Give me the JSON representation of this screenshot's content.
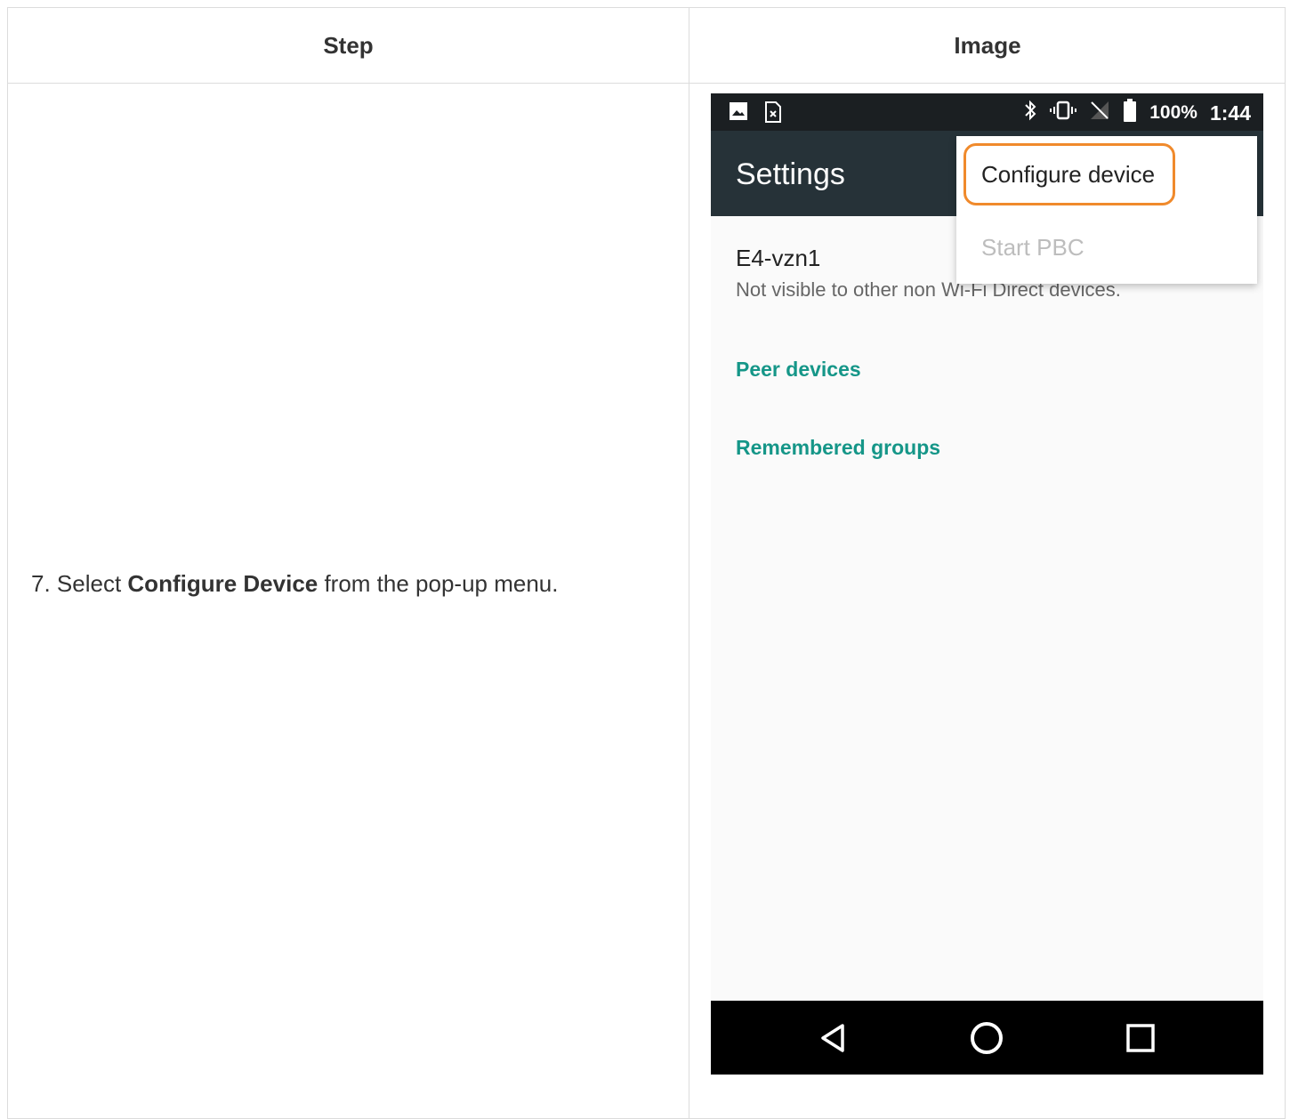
{
  "table": {
    "header_step": "Step",
    "header_image": "Image",
    "step_prefix": "7. Select ",
    "step_bold": "Configure Device",
    "step_suffix": " from the pop-up menu."
  },
  "phone": {
    "status": {
      "battery_percent": "100%",
      "time": "1:44",
      "icons": [
        "gallery-icon",
        "sim-card-icon",
        "bluetooth-icon",
        "vibrate-icon",
        "no-signal-icon",
        "battery-icon"
      ]
    },
    "appbar": {
      "title": "Settings"
    },
    "device": {
      "name": "E4-vzn1",
      "visibility": "Not visible to other non Wi-Fi Direct devices."
    },
    "sections": {
      "peer": "Peer devices",
      "remembered": "Remembered groups"
    },
    "menu": {
      "items": [
        "Configure device",
        "Start PBC"
      ],
      "highlight_color": "#f08a2c"
    },
    "navbar": {
      "icons": [
        "back-icon",
        "home-icon",
        "recents-icon"
      ]
    },
    "colors": {
      "appbar": "#263238",
      "accent": "#159688"
    }
  }
}
